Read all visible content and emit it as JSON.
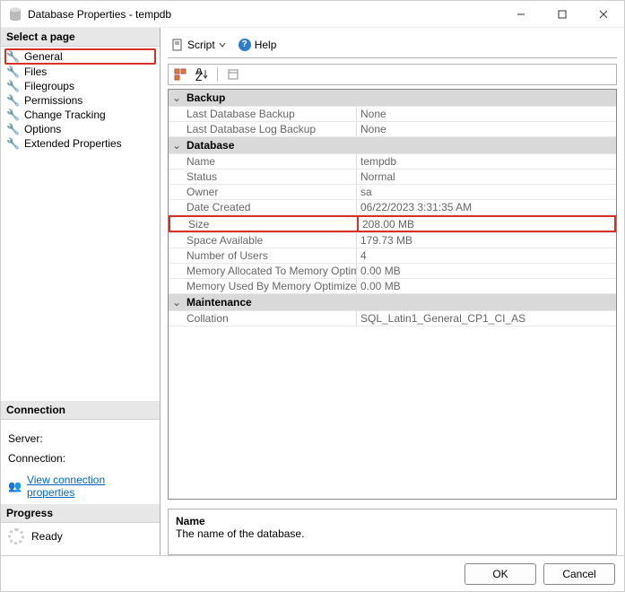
{
  "window": {
    "title": "Database Properties - tempdb"
  },
  "winbuttons": {
    "min": "minimize",
    "max": "maximize",
    "close": "close"
  },
  "leftnav": {
    "select_page_hdr": "Select a page",
    "pages": {
      "general": "General",
      "files": "Files",
      "filegroups": "Filegroups",
      "permissions": "Permissions",
      "change_tracking": "Change Tracking",
      "options": "Options",
      "extended_props": "Extended Properties"
    },
    "connection_hdr": "Connection",
    "server_label": "Server:",
    "server_value": "",
    "connection_label": "Connection:",
    "connection_value": "",
    "view_conn_link": "View connection properties",
    "progress_hdr": "Progress",
    "progress_status": "Ready"
  },
  "toolbar": {
    "script": "Script",
    "help": "Help"
  },
  "gridtoolbar": {
    "categorized": "categorized-icon",
    "alpha": "alpha-sort-icon",
    "pages": "property-pages-icon"
  },
  "props": {
    "backup_cat": "Backup",
    "last_db_backup": {
      "label": "Last Database Backup",
      "value": "None"
    },
    "last_log_backup": {
      "label": "Last Database Log Backup",
      "value": "None"
    },
    "database_cat": "Database",
    "name": {
      "label": "Name",
      "value": "tempdb"
    },
    "status": {
      "label": "Status",
      "value": "Normal"
    },
    "owner": {
      "label": "Owner",
      "value": "sa"
    },
    "date_created": {
      "label": "Date Created",
      "value": "06/22/2023 3:31:35 AM"
    },
    "size": {
      "label": "Size",
      "value": "208.00 MB"
    },
    "space_avail": {
      "label": "Space Available",
      "value": "179.73 MB"
    },
    "num_users": {
      "label": "Number of Users",
      "value": "4"
    },
    "mem_alloc": {
      "label": "Memory Allocated To Memory Optimized Obje",
      "value": "0.00 MB"
    },
    "mem_used": {
      "label": "Memory Used By Memory Optimized Objects",
      "value": "0.00 MB"
    },
    "maintenance_cat": "Maintenance",
    "collation": {
      "label": "Collation",
      "value": "SQL_Latin1_General_CP1_CI_AS"
    }
  },
  "desc": {
    "name_hdr": "Name",
    "name_text": "The name of the database."
  },
  "footer": {
    "ok": "OK",
    "cancel": "Cancel"
  }
}
